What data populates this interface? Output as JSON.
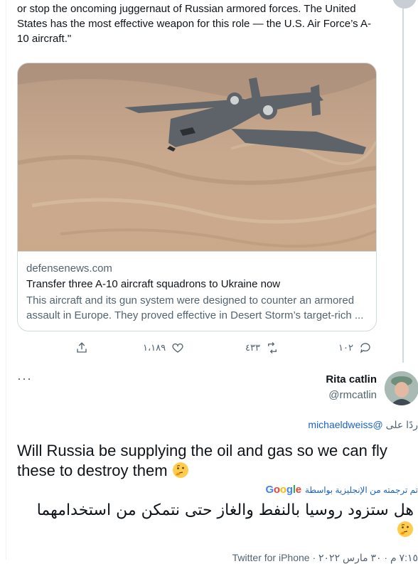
{
  "quoted_tweet": {
    "text": "or stop the oncoming juggernaut of Russian armored forces. The United States has the most effective weapon for this role — the U.S. Air Force’s A-10 aircraft.\"",
    "card": {
      "domain": "defensenews.com",
      "title": "Transfer three A-10 aircraft squadrons to Ukraine now",
      "description": "This aircraft and its gun system were designed to counter an armored assault in Europe. They proved effective in Desert Storm’s target-rich ..."
    },
    "actions": {
      "share_icon": "share-icon",
      "like_count": "١،١٨٩",
      "retweet_count": "٤٣٣",
      "reply_count": "١٠٢"
    }
  },
  "reply_tweet": {
    "more_label": "···",
    "author_name": "Rita catlin",
    "author_handle": "@rmcatlin",
    "replying_to_prefix": "ردًا على",
    "replying_to_handle": "@michaeldweiss",
    "text": "Will Russia be supplying the oil and gas so we can fly these to destroy them",
    "emoji": "thinking-face",
    "translation_label": "تم ترجمته من الإنجليزية بواسطة",
    "google_logo": "Google",
    "translated_text": "هل ستزود روسيا بالنفط والغاز حتى نتمكن من استخدامهما",
    "meta": "٧:١٥ م · ٣٠ مارس ٢٠٢٢ · Twitter for iPhone"
  },
  "colors": {
    "link": "#1b63c2",
    "secondary_text": "#536471",
    "border": "#cfd9de"
  }
}
